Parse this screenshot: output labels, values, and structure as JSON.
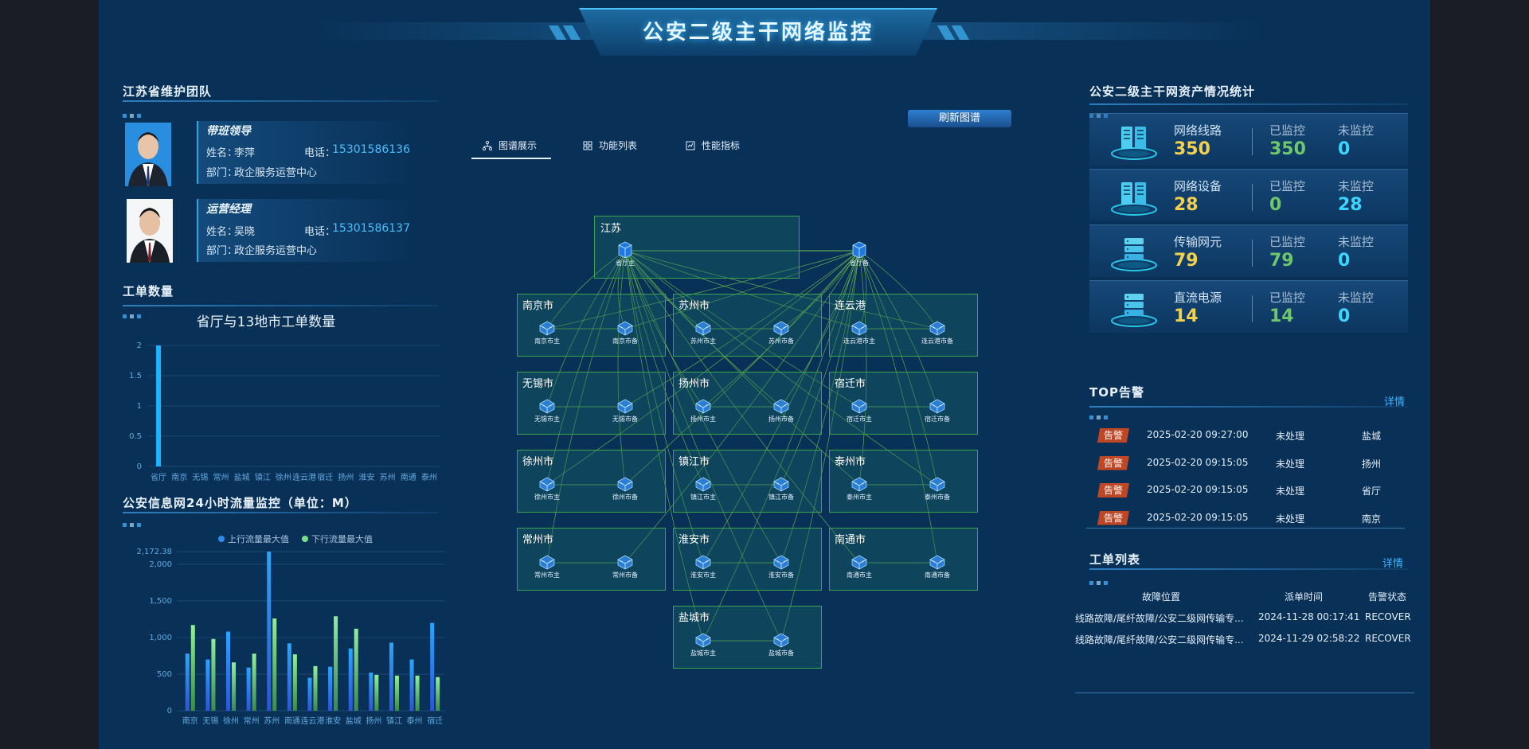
{
  "header": {
    "title": "公安二级主干网络监控"
  },
  "team": {
    "title": "江苏省维护团队",
    "members": [
      {
        "role": "带班领导",
        "name_label": "姓名：",
        "name": "李萍",
        "phone_label": "电话：",
        "phone": "15301586136",
        "dept_label": "部门：",
        "dept": "政企服务运营中心"
      },
      {
        "role": "运营经理",
        "name_label": "姓名：",
        "name": "吴晓",
        "phone_label": "电话：",
        "phone": "15301586137",
        "dept_label": "部门：",
        "dept": "政企服务运营中心"
      }
    ]
  },
  "workorders_count": {
    "section_title": "工单数量"
  },
  "traffic": {
    "section_title": "公安信息网24小时流量监控（单位：M）"
  },
  "tabs": [
    {
      "label": "图谱展示",
      "icon": "topology-icon",
      "active": true
    },
    {
      "label": "功能列表",
      "icon": "grid-icon",
      "active": false
    },
    {
      "label": "性能指标",
      "icon": "chart-icon",
      "active": false
    }
  ],
  "refresh_label": "刷新图谱",
  "topology": {
    "province": {
      "name": "江苏",
      "nodes": [
        "省厅主",
        "省厅备"
      ]
    },
    "cities": [
      {
        "name": "南京市",
        "nodes": [
          "南京市主",
          "南京市备"
        ]
      },
      {
        "name": "苏州市",
        "nodes": [
          "苏州市主",
          "苏州市备"
        ]
      },
      {
        "name": "连云港",
        "nodes": [
          "连云港市主",
          "连云港市备"
        ]
      },
      {
        "name": "无锡市",
        "nodes": [
          "无锡市主",
          "无锡市备"
        ]
      },
      {
        "name": "扬州市",
        "nodes": [
          "扬州市主",
          "扬州市备"
        ]
      },
      {
        "name": "宿迁市",
        "nodes": [
          "宿迁市主",
          "宿迁市备"
        ]
      },
      {
        "name": "徐州市",
        "nodes": [
          "徐州市主",
          "徐州市备"
        ]
      },
      {
        "name": "镇江市",
        "nodes": [
          "镇江市主",
          "镇江市备"
        ]
      },
      {
        "name": "泰州市",
        "nodes": [
          "泰州市主",
          "泰州市备"
        ]
      },
      {
        "name": "常州市",
        "nodes": [
          "常州市主",
          "常州市备"
        ]
      },
      {
        "name": "淮安市",
        "nodes": [
          "淮安市主",
          "淮安市备"
        ]
      },
      {
        "name": "南通市",
        "nodes": [
          "南通市主",
          "南通市备"
        ]
      },
      {
        "name": "盐城市",
        "nodes": [
          "盐城市主",
          "盐城市备"
        ]
      }
    ]
  },
  "assets": {
    "title": "公安二级主干网资产情况统计",
    "monitored_label": "已监控",
    "unmonitored_label": "未监控",
    "rows": [
      {
        "name": "网络线路",
        "total": "350",
        "monitored": "350",
        "unmonitored": "0",
        "icon": "server-rack-icon"
      },
      {
        "name": "网络设备",
        "total": "28",
        "monitored": "0",
        "unmonitored": "28",
        "icon": "server-rack-icon"
      },
      {
        "name": "传输网元",
        "total": "79",
        "monitored": "79",
        "unmonitored": "0",
        "icon": "server-stack-icon"
      },
      {
        "name": "直流电源",
        "total": "14",
        "monitored": "14",
        "unmonitored": "0",
        "icon": "server-stack-icon"
      }
    ]
  },
  "alarms": {
    "title": "TOP告警",
    "more": "详情",
    "rows": [
      {
        "badge": "告警",
        "time": "2025-02-20 09:27:00",
        "status": "未处理",
        "location": "盐城"
      },
      {
        "badge": "告警",
        "time": "2025-02-20 09:15:05",
        "status": "未处理",
        "location": "扬州"
      },
      {
        "badge": "告警",
        "time": "2025-02-20 09:15:05",
        "status": "未处理",
        "location": "省厅"
      },
      {
        "badge": "告警",
        "time": "2025-02-20 09:15:05",
        "status": "未处理",
        "location": "南京"
      }
    ]
  },
  "workorders": {
    "title": "工单列表",
    "more": "详情",
    "columns": [
      "故障位置",
      "派单时间",
      "告警状态"
    ],
    "rows": [
      {
        "location": "线路故障/尾纤故障/公安二级网传输专...",
        "time": "2024-11-28 00:17:41",
        "status": "RECOVER"
      },
      {
        "location": "线路故障/尾纤故障/公安二级网传输专...",
        "time": "2024-11-29 02:58:22",
        "status": "RECOVER"
      }
    ]
  },
  "colors": {
    "accent": "#2fa6e8",
    "bar_up": "#2b8df0",
    "bar_down": "#7be08a",
    "count_bar": "#19b6ff",
    "region_border": "#3aa54a",
    "link": "#6fbf4a"
  },
  "chart_data": [
    {
      "type": "bar",
      "title": "省厅与13地市工单数量",
      "categories": [
        "省厅",
        "南京",
        "无锡",
        "常州",
        "盐城",
        "镇江",
        "徐州",
        "连云港",
        "宿迁",
        "扬州",
        "淮安",
        "苏州",
        "南通",
        "泰州"
      ],
      "values": [
        2,
        0,
        0,
        0,
        0,
        0,
        0,
        0,
        0,
        0,
        0,
        0,
        0,
        0
      ],
      "yticks": [
        "0",
        "0.5",
        "1",
        "1.5",
        "2"
      ],
      "ylim": [
        0,
        2
      ]
    },
    {
      "type": "bar",
      "categories": [
        "南京",
        "无锡",
        "徐州",
        "常州",
        "苏州",
        "南通",
        "连云港",
        "淮安",
        "盐城",
        "扬州",
        "镇江",
        "泰州",
        "宿迁"
      ],
      "series": [
        {
          "name": "上行流量最大值",
          "values": [
            780,
            700,
            1080,
            590,
            2172.38,
            920,
            450,
            600,
            850,
            520,
            930,
            700,
            1200
          ]
        },
        {
          "name": "下行流量最大值",
          "values": [
            1170,
            980,
            660,
            780,
            1260,
            770,
            610,
            1290,
            1120,
            490,
            480,
            480,
            460
          ]
        }
      ],
      "yticks": [
        "0",
        "500",
        "1,000",
        "1,500",
        "2,000",
        "2,172.38"
      ],
      "ylim": [
        0,
        2172.38
      ]
    }
  ]
}
